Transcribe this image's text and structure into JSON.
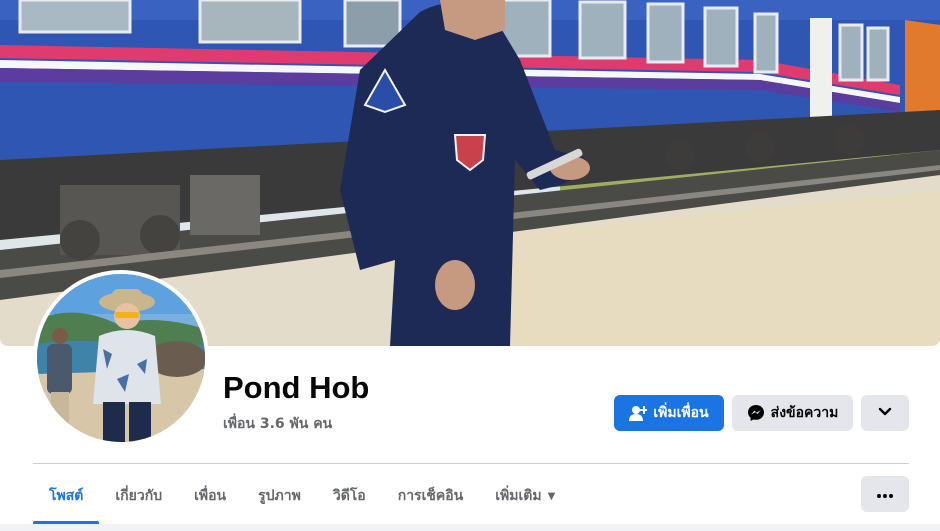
{
  "profile": {
    "name": "Pond Hob",
    "friends": "เพื่อน 3.6 พัน คน"
  },
  "actions": {
    "add_friend_label": "เพิ่มเพื่อน",
    "message_label": "ส่งข้อความ",
    "add_friend_icon": "person-plus-icon",
    "message_icon": "messenger-icon",
    "more_icon": "chevron-down-icon"
  },
  "tabs": [
    {
      "label": "โพสต์",
      "active": true
    },
    {
      "label": "เกี่ยวกับ",
      "active": false
    },
    {
      "label": "เพื่อน",
      "active": false
    },
    {
      "label": "รูปภาพ",
      "active": false
    },
    {
      "label": "วิดีโอ",
      "active": false
    },
    {
      "label": "การเช็คอิน",
      "active": false
    },
    {
      "label": "เพิ่มเติม",
      "active": false
    }
  ],
  "tab_menu_icon": "ellipsis-icon",
  "colors": {
    "accent": "#1b74e4",
    "button_gray": "#e4e6eb",
    "secondary_text": "#65676b"
  }
}
